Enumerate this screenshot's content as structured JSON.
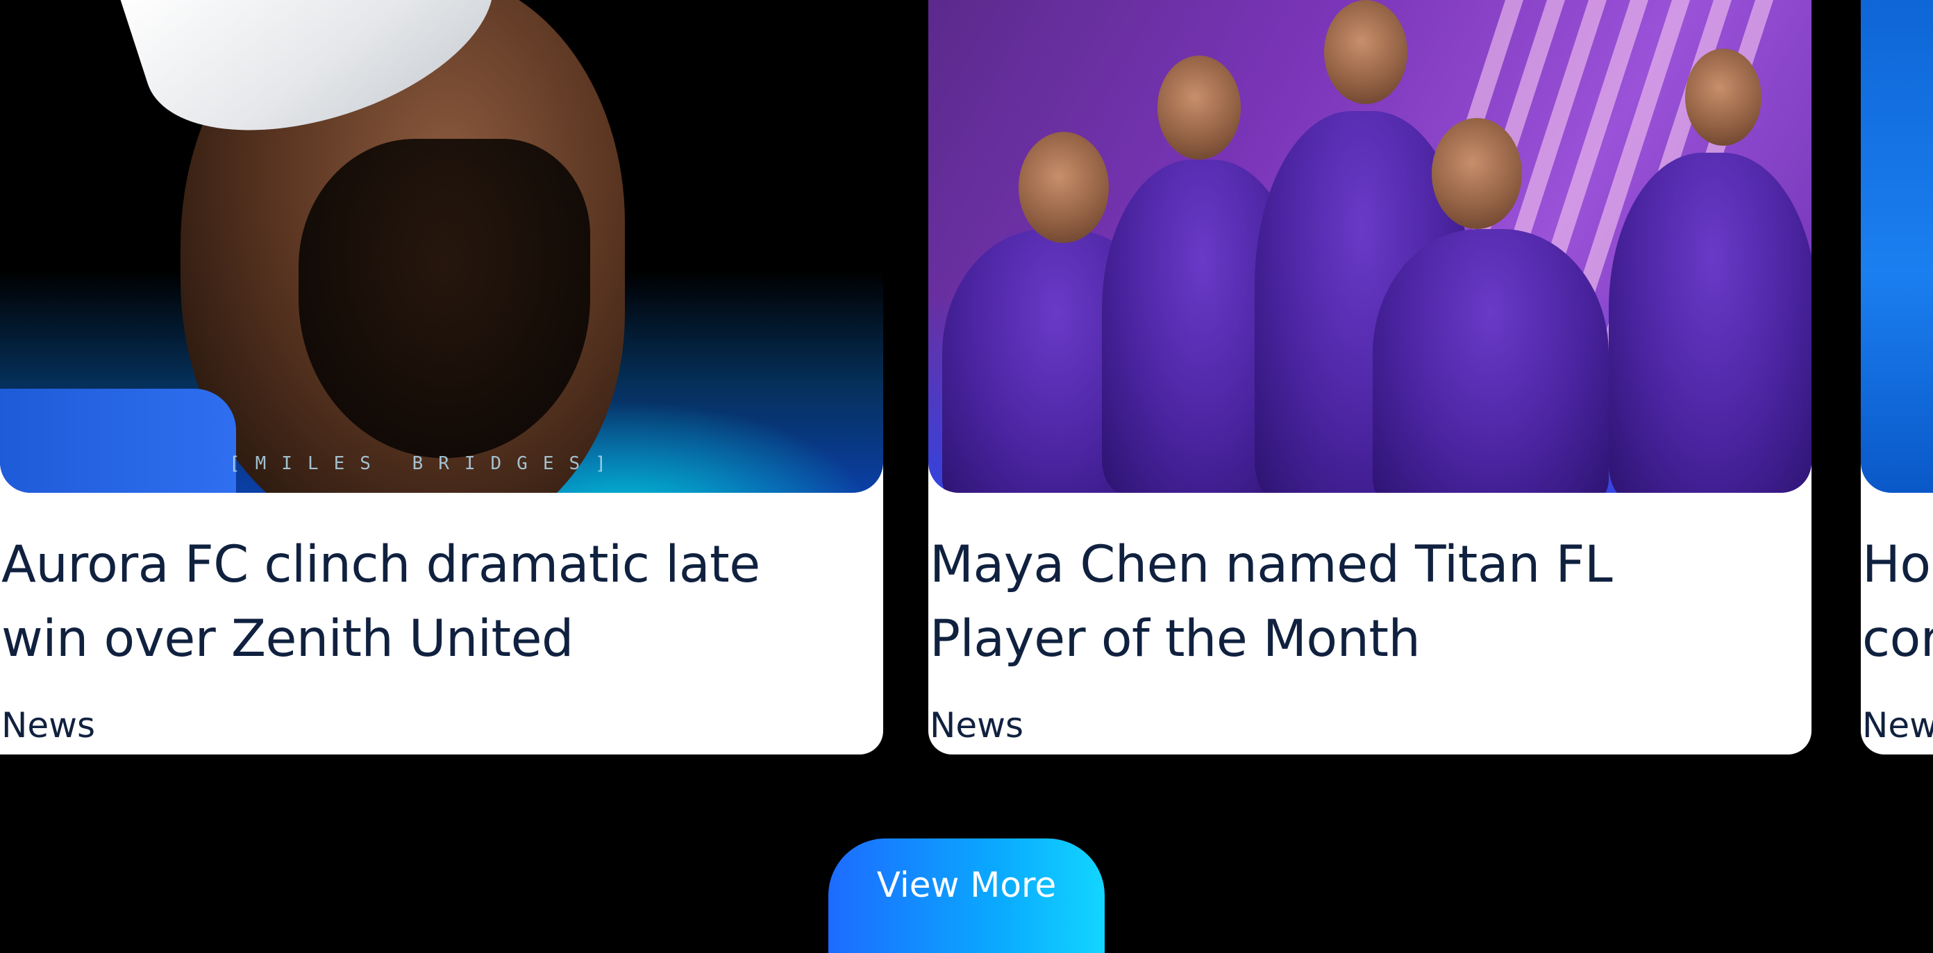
{
  "cards": [
    {
      "title_line1": "Aurora FC clinch dramatic late",
      "title_line2": "win over Zenith United",
      "tag": "News",
      "image_caption": "[MILES BRIDGES]"
    },
    {
      "title_line1": "Maya Chen named Titan FL",
      "title_line2": "Player of the Month",
      "tag": "News"
    },
    {
      "title_line1": "Hor",
      "title_line2": "cor",
      "tag": "New"
    }
  ],
  "view_more_label": "View More",
  "colors": {
    "background": "#000000",
    "card": "#ffffff",
    "text": "#10213f",
    "button_start": "#1d6bff",
    "button_end": "#12d6ff"
  }
}
